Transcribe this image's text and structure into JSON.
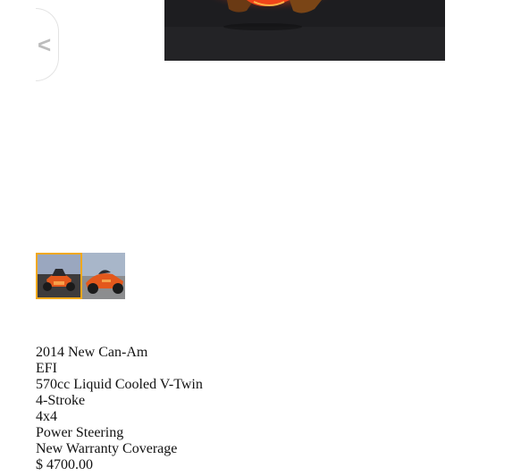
{
  "gallery": {
    "prev_label": "<",
    "thumbnails": [
      {
        "alt": "Can-Am Spyder front view",
        "selected": true
      },
      {
        "alt": "Can-Am Spyder side view",
        "selected": false
      }
    ]
  },
  "listing": {
    "lines": [
      "2014 New Can-Am",
      "EFI",
      "570cc Liquid Cooled V-Twin",
      "4-Stroke",
      "4x4",
      "Power Steering",
      "New Warranty Coverage",
      "$ 4700.00"
    ]
  },
  "colors": {
    "selected_thumb_border": "#f0a81c",
    "vehicle_orange": "#e3581c"
  }
}
